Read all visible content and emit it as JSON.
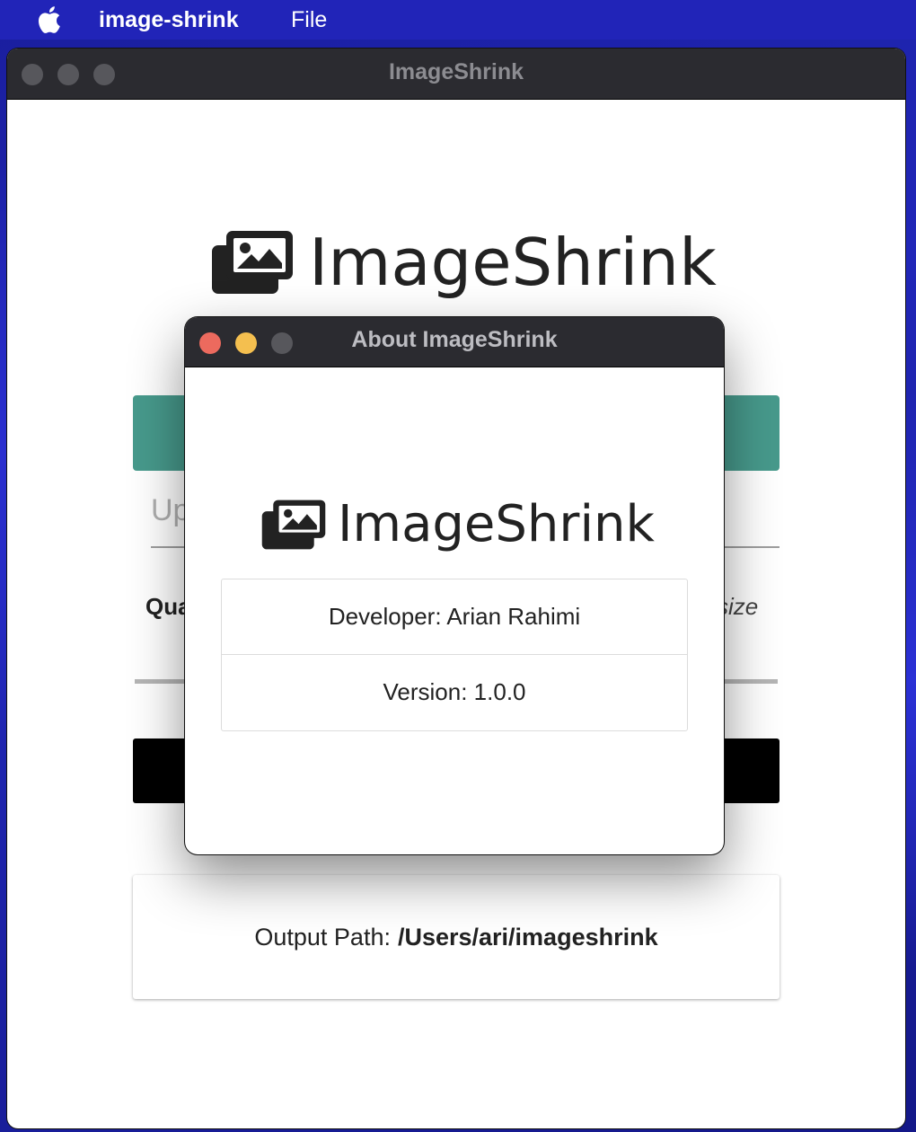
{
  "menubar": {
    "app_name": "image-shrink",
    "file_menu": "File"
  },
  "main_window": {
    "title": "ImageShrink",
    "brand": "ImageShrink",
    "upload_placeholder": "Up",
    "quality_label": "Qua",
    "resize_label": "size",
    "output_path_label": "Output Path:",
    "output_path_value": "/Users/ari/imageshrink"
  },
  "about_dialog": {
    "title": "About ImageShrink",
    "brand": "ImageShrink",
    "developer": "Developer: Arian Rahimi",
    "version": "Version: 1.0.0"
  },
  "colors": {
    "close": "#ec6a5e",
    "minimize": "#f4bf4f",
    "inactive": "#57575c",
    "teal": "#479a8c"
  }
}
